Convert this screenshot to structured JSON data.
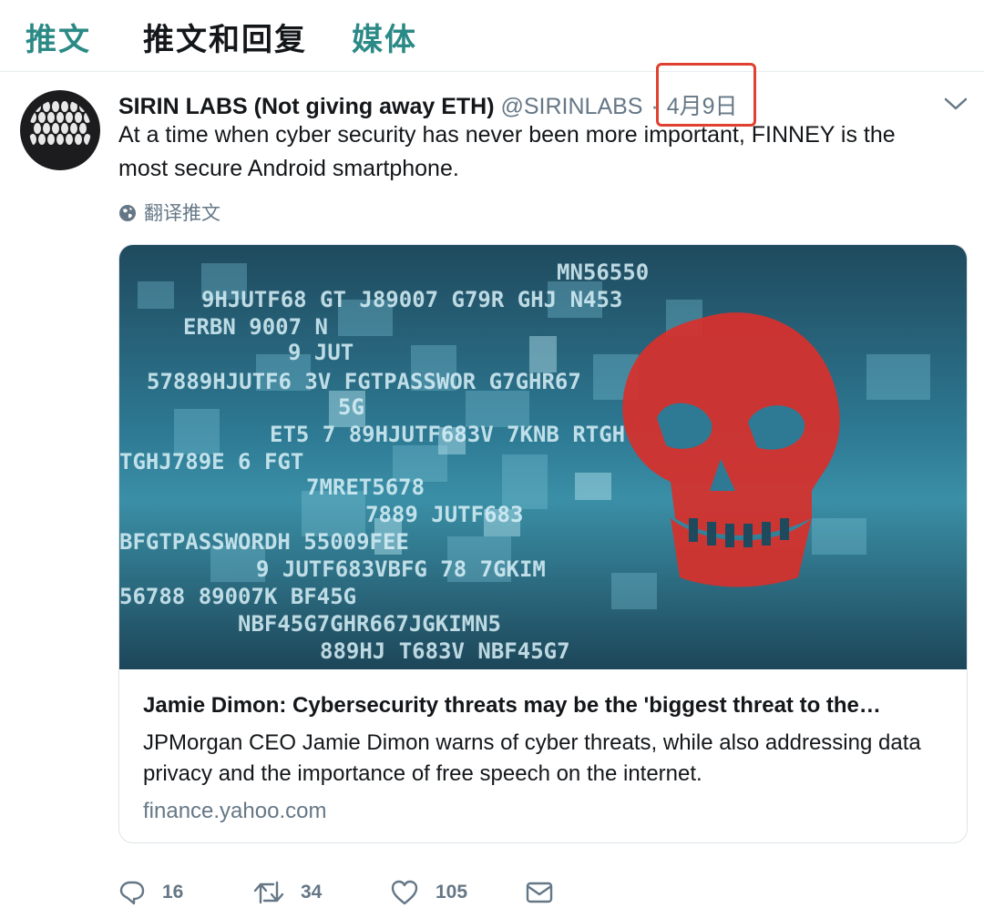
{
  "tabs": [
    {
      "label": "推文"
    },
    {
      "label": "推文和回复"
    },
    {
      "label": "媒体"
    }
  ],
  "tweet": {
    "display_name": "SIRIN LABS (Not giving away ETH)",
    "handle": "@SIRINLABS",
    "separator": "·",
    "date": "4月9日",
    "text": "At a time when cyber security has never been more important, FINNEY is the most secure Android smartphone.",
    "translate_label": "翻译推文"
  },
  "card": {
    "title": "Jamie Dimon: Cybersecurity threats may be the 'biggest threat to the…",
    "description": "JPMorgan CEO Jamie Dimon warns of cyber threats, while also addressing data privacy and the importance of free speech on the internet.",
    "domain": "finance.yahoo.com",
    "image_text": [
      "MN56550",
      "9HJUTF68 GT J89007 G79R GHJ N453",
      "ERBN 9007 N",
      "9 JUT",
      "57889HJUTF6 3V FGTPASSWOR G7GHR67",
      "5G",
      "ET5 7 89HJUTF683V 7KNB RTGH",
      "TGHJ789E 6 FGT",
      "7MRET5678",
      "7889 JUTF683",
      "BFGTPASSWORDH 55009FEE",
      "9 JUTF683VBFG 78 7GKIM",
      "56788 89007K BF45G",
      "NBF45G7GHR667JGKIMN5",
      "889HJ T683V NBF45G7"
    ]
  },
  "actions": {
    "reply_count": "16",
    "retweet_count": "34",
    "like_count": "105"
  },
  "colors": {
    "accent_tab": "#2b8a86",
    "highlight_box": "#e0402f",
    "skull": "#d8302b",
    "secondary_text": "#657786"
  },
  "icons": [
    "globe-icon",
    "chevron-down-icon",
    "reply-icon",
    "retweet-icon",
    "like-icon",
    "message-icon"
  ]
}
